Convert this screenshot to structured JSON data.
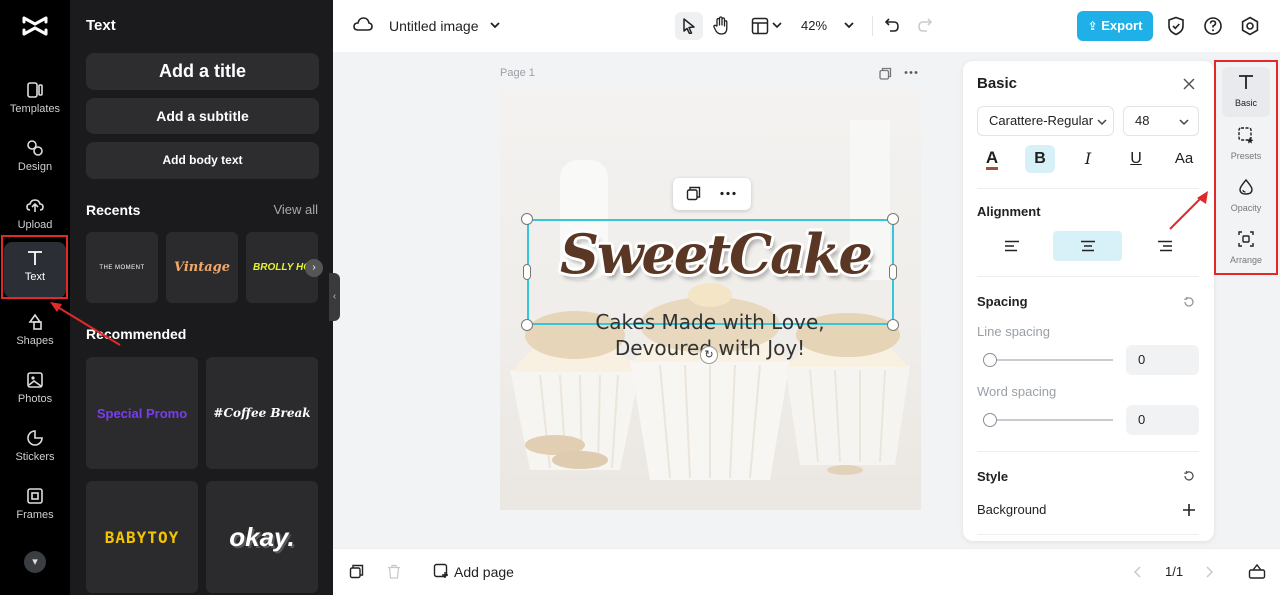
{
  "app": {
    "name": "CapCut"
  },
  "rail": {
    "items": [
      {
        "label": "Templates",
        "icon": "templates-icon"
      },
      {
        "label": "Design",
        "icon": "design-icon"
      },
      {
        "label": "Upload",
        "icon": "upload-icon"
      },
      {
        "label": "Text",
        "icon": "text-icon",
        "active": true
      },
      {
        "label": "Shapes",
        "icon": "shapes-icon"
      },
      {
        "label": "Photos",
        "icon": "photos-icon"
      },
      {
        "label": "Stickers",
        "icon": "stickers-icon"
      },
      {
        "label": "Frames",
        "icon": "frames-icon"
      }
    ]
  },
  "text_panel": {
    "title": "Text",
    "add_title": "Add a title",
    "add_subtitle": "Add a subtitle",
    "add_body": "Add body text",
    "recents_label": "Recents",
    "view_all": "View all",
    "recents": [
      "THE MOMENT",
      "Vintage",
      "BROLLY HO"
    ],
    "recommended_label": "Recommended",
    "recommended": [
      "Special Promo",
      "#Coffee Break",
      "BABYTOY",
      "okay."
    ]
  },
  "topbar": {
    "doc_title": "Untitled image",
    "zoom": "42%",
    "export_label": "Export",
    "accent": "#1fb0e8"
  },
  "canvas": {
    "page_label": "Page 1",
    "headline": "SweetCake",
    "subline_1": "Cakes Made with Love,",
    "subline_2": "Devoured with Joy!"
  },
  "props": {
    "title": "Basic",
    "font": "Carattere-Regular",
    "size": "48",
    "alignment_label": "Alignment",
    "spacing_label": "Spacing",
    "line_spacing_label": "Line spacing",
    "line_spacing_value": "0",
    "word_spacing_label": "Word spacing",
    "word_spacing_value": "0",
    "style_label": "Style",
    "background_label": "Background"
  },
  "side_tabs": [
    {
      "label": "Basic",
      "icon": "text-icon",
      "active": true
    },
    {
      "label": "Presets",
      "icon": "presets-icon"
    },
    {
      "label": "Opacity",
      "icon": "opacity-icon"
    },
    {
      "label": "Arrange",
      "icon": "arrange-icon"
    }
  ],
  "bottombar": {
    "add_page": "Add page",
    "page_counter": "1/1"
  }
}
